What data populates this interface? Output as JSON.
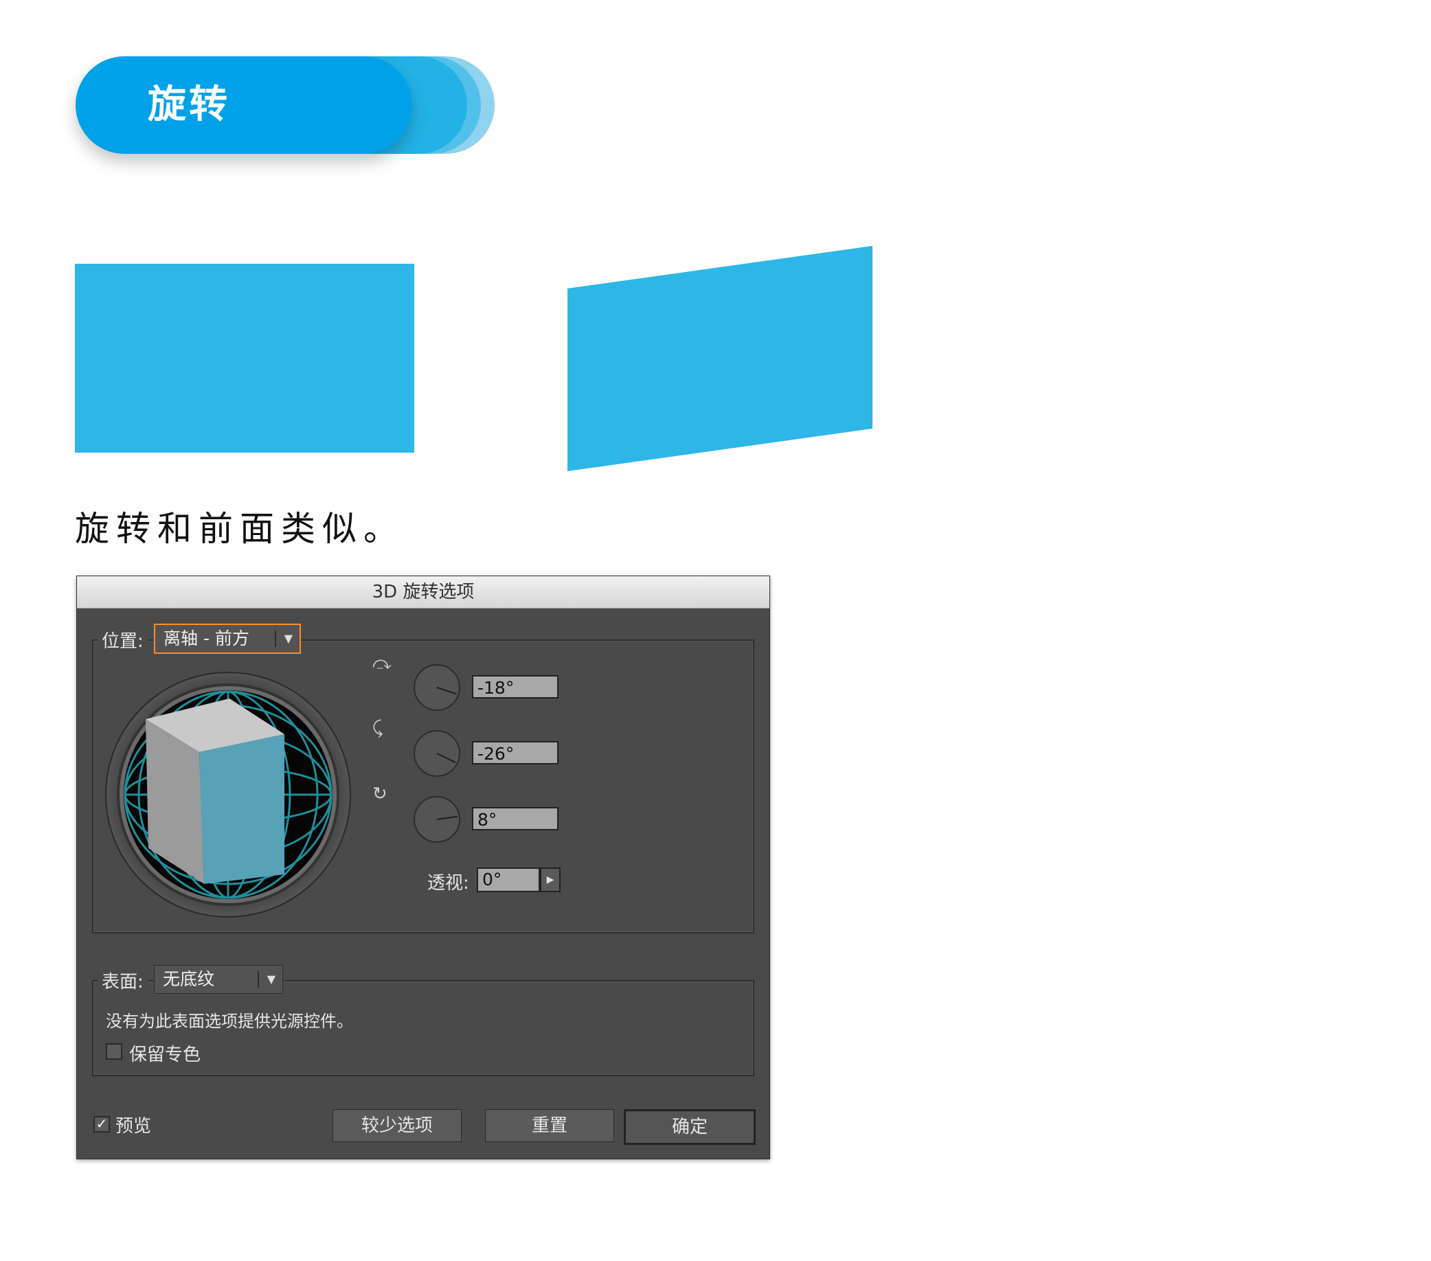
{
  "header": {
    "title": "旋转"
  },
  "caption": "旋转和前面类似。",
  "colors": {
    "accent": "#00a1e9",
    "shape": "#2db6e6",
    "dialog_bg": "#4a4a4a"
  },
  "dialog": {
    "title": "3D 旋转选项",
    "position": {
      "label": "位置:",
      "value": "离轴 - 前方"
    },
    "rotation": {
      "x": "-18°",
      "y": "-26°",
      "z": "8°"
    },
    "perspective": {
      "label": "透视:",
      "value": "0°"
    },
    "surface": {
      "label": "表面:",
      "value": "无底纹",
      "note": "没有为此表面选项提供光源控件。",
      "preserve_spot_label": "保留专色",
      "preserve_spot_checked": false
    },
    "preview": {
      "label": "预览",
      "checked": true
    },
    "buttons": {
      "fewer": "较少选项",
      "reset": "重置",
      "ok": "确定"
    }
  }
}
